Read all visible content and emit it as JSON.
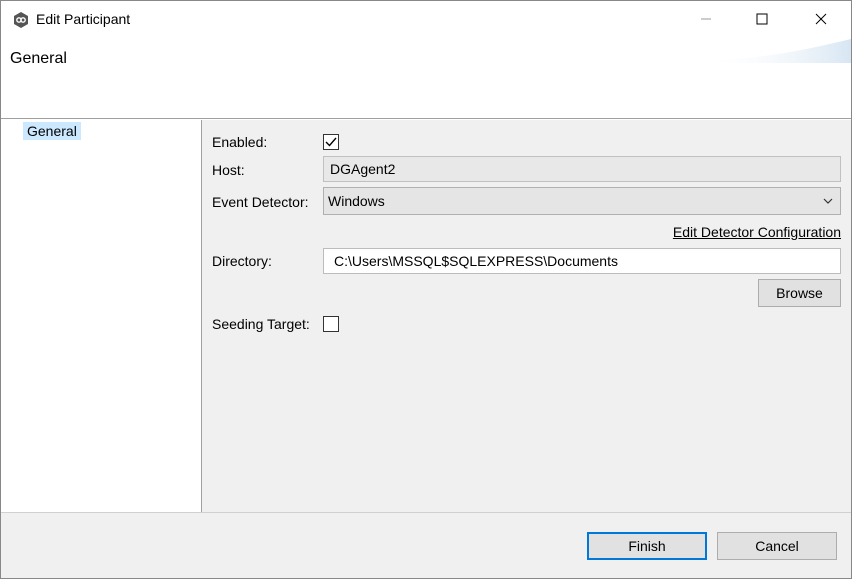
{
  "window": {
    "title": "Edit Participant",
    "icons": {
      "app": "app-logo-icon",
      "minimize": "minimize-icon",
      "maximize": "maximize-icon",
      "close": "close-icon"
    }
  },
  "header": {
    "title": "General"
  },
  "nav": {
    "items": [
      {
        "label": "General",
        "selected": true
      }
    ]
  },
  "form": {
    "enabled": {
      "label": "Enabled:",
      "checked": true
    },
    "host": {
      "label": "Host:",
      "value": "DGAgent2"
    },
    "event_detector": {
      "label": "Event Detector:",
      "value": "Windows"
    },
    "edit_detector_link": "Edit Detector Configuration",
    "directory": {
      "label": "Directory:",
      "value": "C:\\Users\\MSSQL$SQLEXPRESS\\Documents"
    },
    "browse_label": "Browse",
    "seeding_target": {
      "label": "Seeding Target:",
      "checked": false
    }
  },
  "footer": {
    "finish_label": "Finish",
    "cancel_label": "Cancel"
  },
  "colors": {
    "selection": "#cce8ff",
    "panel_bg": "#f0f0f0",
    "primary_border": "#0078d7"
  }
}
